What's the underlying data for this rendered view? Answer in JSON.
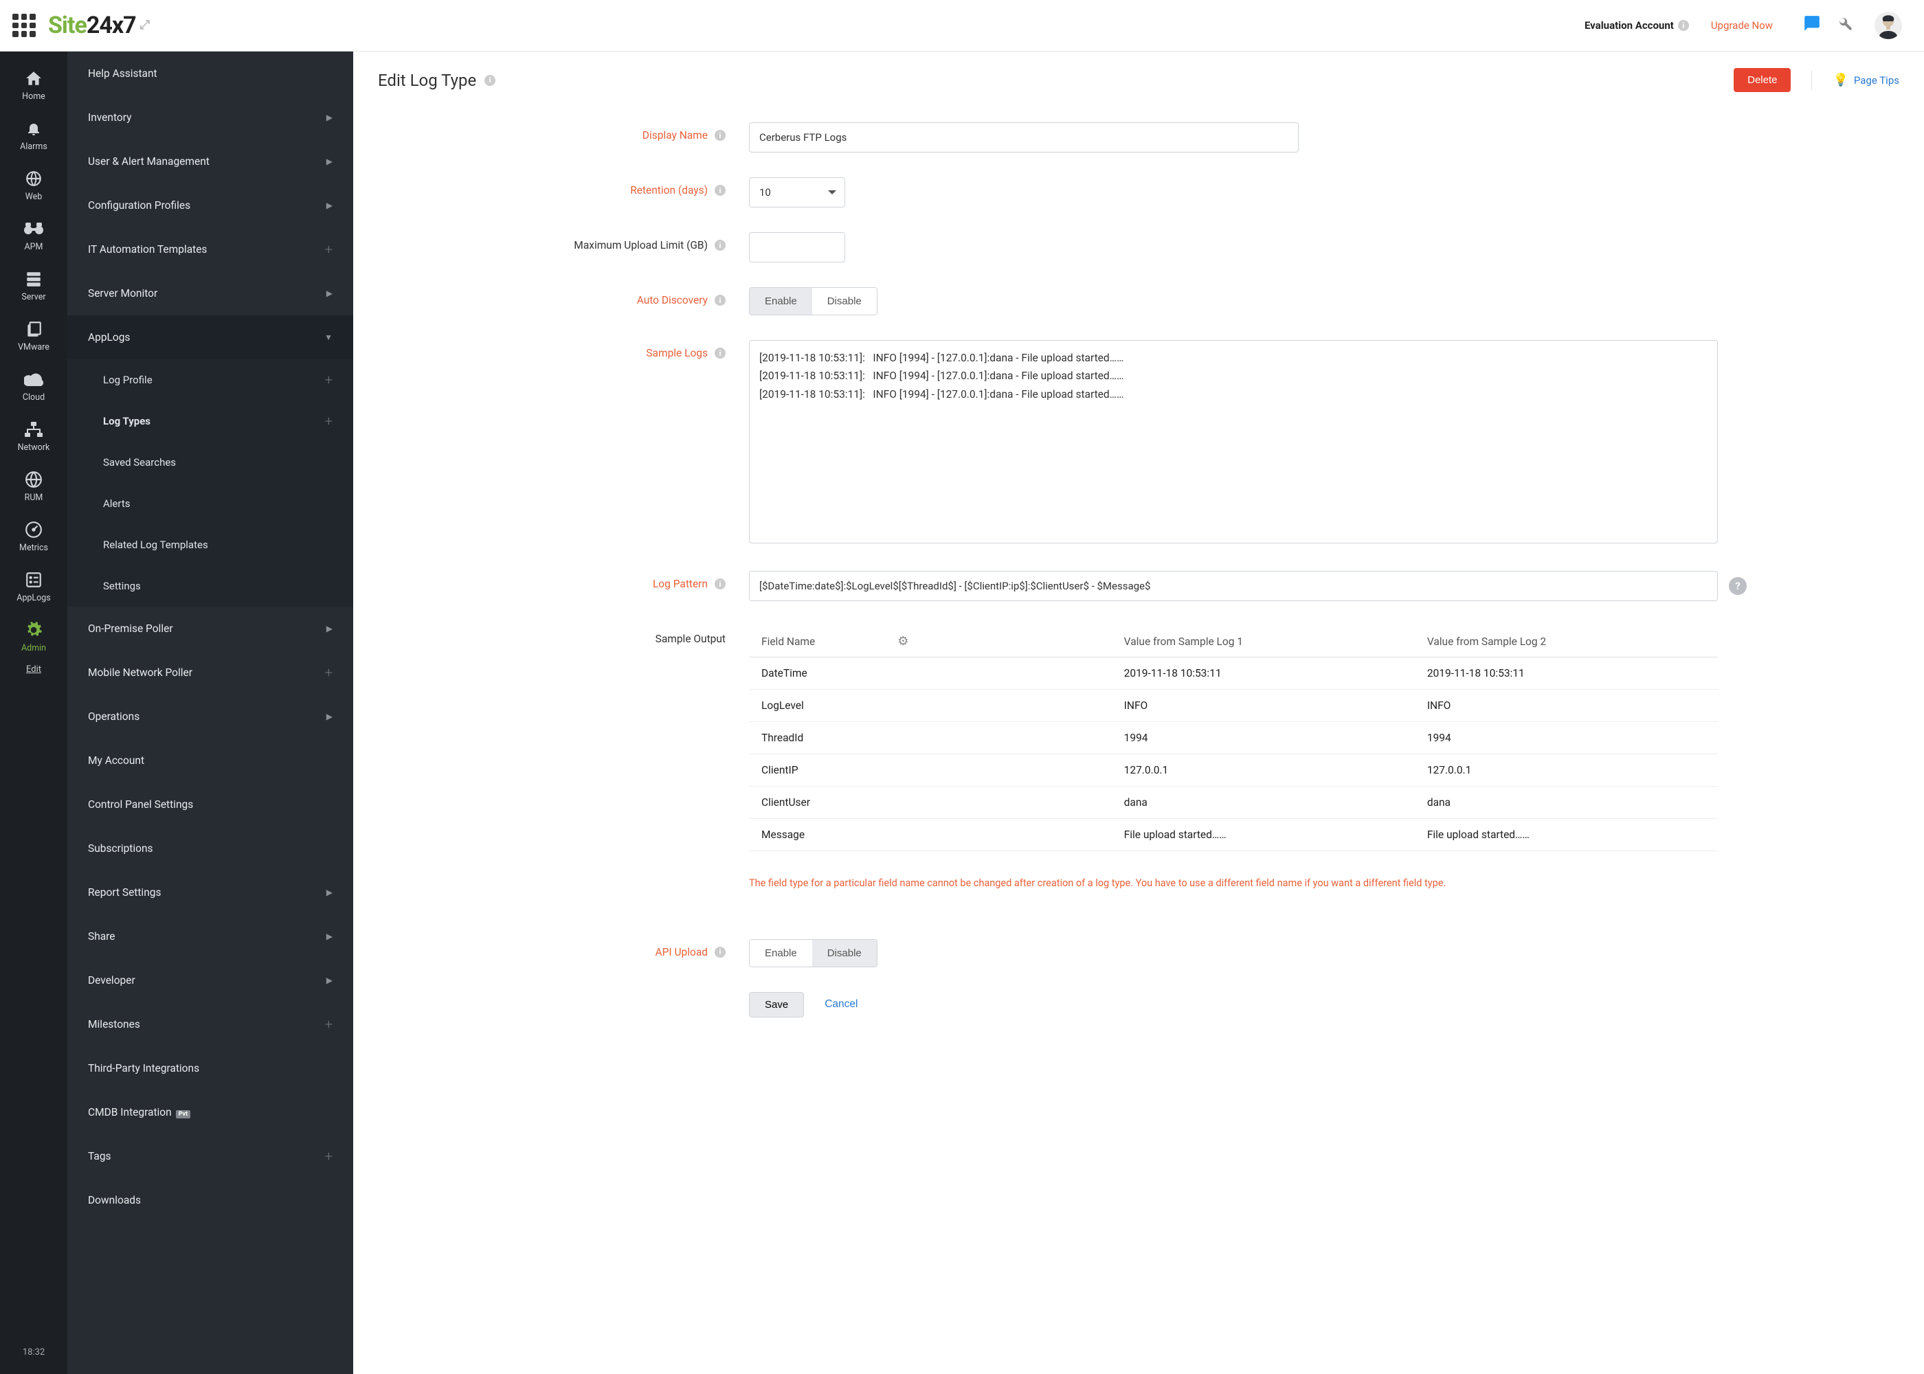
{
  "topbar": {
    "product": {
      "part1": "Site",
      "part2": "24x7"
    },
    "eval_label": "Evaluation Account",
    "upgrade_label": "Upgrade Now"
  },
  "rail": {
    "items": [
      {
        "icon": "home",
        "label": "Home"
      },
      {
        "icon": "bell",
        "label": "Alarms"
      },
      {
        "icon": "globe",
        "label": "Web"
      },
      {
        "icon": "binoculars",
        "label": "APM"
      },
      {
        "icon": "stack",
        "label": "Server"
      },
      {
        "icon": "sheets",
        "label": "VMware"
      },
      {
        "icon": "cloud",
        "label": "Cloud"
      },
      {
        "icon": "network",
        "label": "Network"
      },
      {
        "icon": "world",
        "label": "RUM"
      },
      {
        "icon": "gauge",
        "label": "Metrics"
      },
      {
        "icon": "applogs",
        "label": "AppLogs"
      }
    ],
    "admin_label": "Admin",
    "edit_label": "Edit",
    "time": "18:32"
  },
  "sidebar": {
    "items": [
      {
        "label": "Help Assistant",
        "type": "plain"
      },
      {
        "label": "Inventory",
        "type": "expand"
      },
      {
        "label": "User & Alert Management",
        "type": "expand"
      },
      {
        "label": "Configuration Profiles",
        "type": "expand"
      },
      {
        "label": "IT Automation Templates",
        "type": "add"
      },
      {
        "label": "Server Monitor",
        "type": "expand"
      },
      {
        "label": "AppLogs",
        "type": "expand",
        "open": true,
        "children": [
          {
            "label": "Log Profile",
            "type": "add"
          },
          {
            "label": "Log Types",
            "type": "add",
            "active": true
          },
          {
            "label": "Saved Searches",
            "type": "plain"
          },
          {
            "label": "Alerts",
            "type": "plain"
          },
          {
            "label": "Related Log Templates",
            "type": "plain"
          },
          {
            "label": "Settings",
            "type": "plain"
          }
        ]
      },
      {
        "label": "On-Premise Poller",
        "type": "expand"
      },
      {
        "label": "Mobile Network Poller",
        "type": "add"
      },
      {
        "label": "Operations",
        "type": "expand"
      },
      {
        "label": "My Account",
        "type": "plain"
      },
      {
        "label": "Control Panel Settings",
        "type": "plain"
      },
      {
        "label": "Subscriptions",
        "type": "plain"
      },
      {
        "label": "Report Settings",
        "type": "expand"
      },
      {
        "label": "Share",
        "type": "expand"
      },
      {
        "label": "Developer",
        "type": "expand"
      },
      {
        "label": "Milestones",
        "type": "add"
      },
      {
        "label": "Third-Party Integrations",
        "type": "plain"
      },
      {
        "label": "CMDB Integration",
        "type": "badge",
        "badge": "Pvt"
      },
      {
        "label": "Tags",
        "type": "add"
      },
      {
        "label": "Downloads",
        "type": "plain"
      }
    ]
  },
  "page": {
    "title": "Edit Log Type",
    "delete": "Delete",
    "tips": "Page Tips"
  },
  "form": {
    "display_name": {
      "label": "Display Name",
      "value": "Cerberus FTP Logs"
    },
    "retention": {
      "label": "Retention (days)",
      "value": "10"
    },
    "max_upload": {
      "label": "Maximum Upload Limit (GB)",
      "value": ""
    },
    "auto_discovery": {
      "label": "Auto Discovery",
      "enable": "Enable",
      "disable": "Disable",
      "state": "enable"
    },
    "sample_logs": {
      "label": "Sample Logs",
      "value": "[2019-11-18 10:53:11]:   INFO [1994] - [127.0.0.1]:dana - File upload started……\n[2019-11-18 10:53:11]:   INFO [1994] - [127.0.0.1]:dana - File upload started……\n[2019-11-18 10:53:11]:   INFO [1994] - [127.0.0.1]:dana - File upload started……"
    },
    "log_pattern": {
      "label": "Log Pattern",
      "value": "[$DateTime:date$]:$LogLevel$[$ThreadId$] - [$ClientIP:ip$]:$ClientUser$ - $Message$"
    },
    "sample_output": {
      "label": "Sample Output",
      "headers": [
        "Field Name",
        "Value from Sample Log 1",
        "Value from Sample Log 2"
      ],
      "rows": [
        [
          "DateTime",
          "2019-11-18 10:53:11",
          "2019-11-18 10:53:11"
        ],
        [
          "LogLevel",
          "INFO",
          "INFO"
        ],
        [
          "ThreadId",
          "1994",
          "1994"
        ],
        [
          "ClientIP",
          "127.0.0.1",
          "127.0.0.1"
        ],
        [
          "ClientUser",
          "dana",
          "dana"
        ],
        [
          "Message",
          "File upload started……",
          "File upload started……"
        ]
      ]
    },
    "warn": "The field type for a particular field name cannot be changed after creation of a log type. You have to use a different field name if you want a different field type.",
    "api_upload": {
      "label": "API Upload",
      "enable": "Enable",
      "disable": "Disable",
      "state": "disable"
    },
    "save": "Save",
    "cancel": "Cancel"
  }
}
